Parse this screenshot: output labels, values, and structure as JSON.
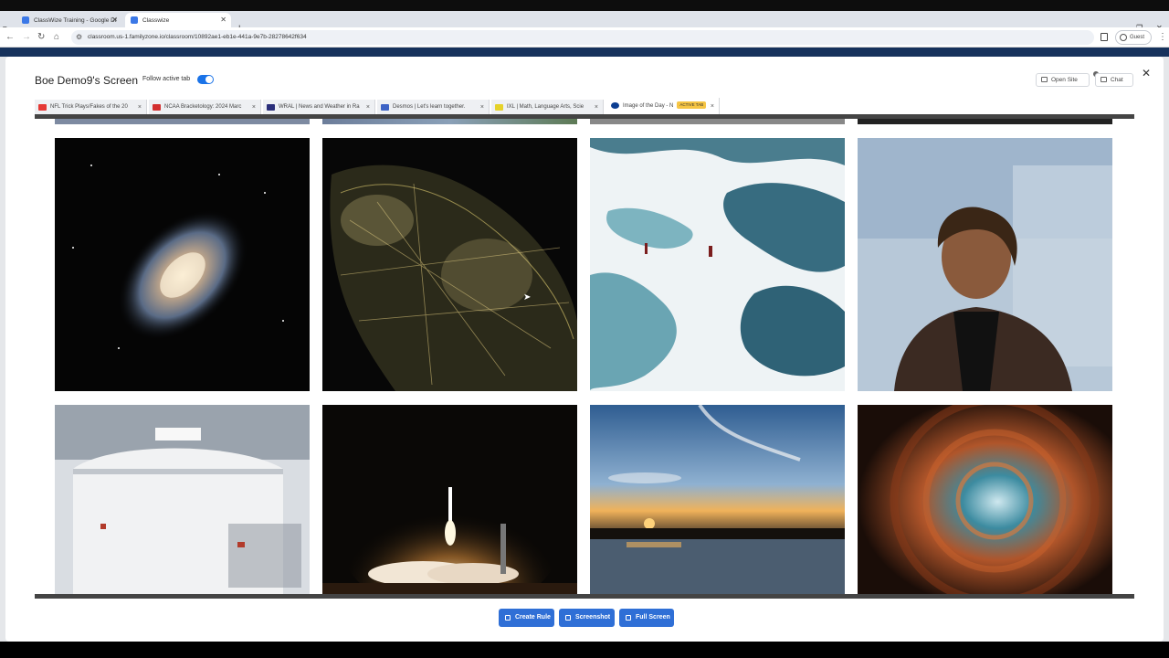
{
  "browser": {
    "tabs": [
      {
        "title": "ClassWize Training - Google Dr",
        "active": false
      },
      {
        "title": "Classwize",
        "active": true
      }
    ],
    "url": "classroom.us-1.familyzone.io/classroom/10892ae1-eb1e-441a-9e7b-28278642f634",
    "profile": "Guest"
  },
  "modal": {
    "title": "Boe Demo9's Screen",
    "follow_label": "Follow active tab",
    "follow_enabled": true,
    "open_site_label": "Open Site",
    "chat_label": "Chat"
  },
  "student_tabs": [
    {
      "title": "NFL Trick Plays/Fakes of the 20",
      "fav_color": "#e53935"
    },
    {
      "title": "NCAA Bracketology: 2024 Marc",
      "fav_color": "#d32f2f"
    },
    {
      "title": "WRAL | News and Weather in Ra",
      "fav_color": "#2b2f7a"
    },
    {
      "title": "Desmos | Let's learn together.",
      "fav_color": "#3d63c5"
    },
    {
      "title": "IXL | Math, Language Arts, Scie",
      "fav_color": "#e6d22a"
    },
    {
      "title": "Image of the Day - N",
      "fav_color": "#0b3d91",
      "active": true,
      "badge": "ACTIVE TAB"
    }
  ],
  "gallery": [
    {
      "name": "spiral-galaxy-image"
    },
    {
      "name": "city-lights-from-space-image"
    },
    {
      "name": "arctic-melt-ponds-image"
    },
    {
      "name": "woman-portrait-image"
    },
    {
      "name": "spacecraft-assembly-image"
    },
    {
      "name": "rocket-launch-night-image"
    },
    {
      "name": "sunset-over-water-image"
    },
    {
      "name": "spiral-galaxy-infrared-image"
    }
  ],
  "actions": {
    "create_rule": "Create Rule",
    "screenshot": "Screenshot",
    "full_screen": "Full Screen"
  }
}
